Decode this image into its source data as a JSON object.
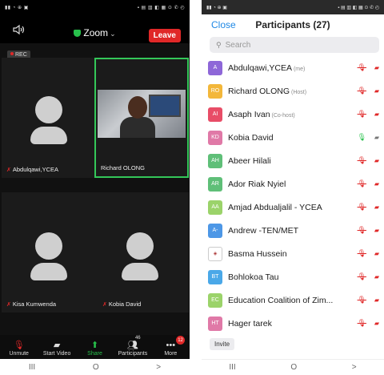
{
  "left": {
    "meeting_title": "Zoom",
    "leave_label": "Leave",
    "rec_label": "REC",
    "tiles": [
      {
        "name": "Abdulqawi,YCEA"
      },
      {
        "name": "Richard OLONG"
      },
      {
        "name": "Kisa Kumwenda"
      },
      {
        "name": "Kobia David"
      }
    ],
    "toolbar": {
      "unmute": "Unmute",
      "start_video": "Start Video",
      "share": "Share",
      "participants": "Participants",
      "participants_count": "46",
      "more": "More",
      "more_badge": "12"
    },
    "nav": {
      "recents": "III",
      "home": "O",
      "back": ">"
    }
  },
  "right": {
    "close_label": "Close",
    "title": "Participants (27)",
    "search_placeholder": "Search",
    "participants": [
      {
        "initials": "A",
        "name": "Abdulqawi,YCEA",
        "role": "(me)",
        "color": "#8e67d8",
        "mic": "muted",
        "cam": "off"
      },
      {
        "initials": "RO",
        "name": "Richard OLONG",
        "role": "(Host)",
        "color": "#f3b73a",
        "mic": "muted",
        "cam": "off"
      },
      {
        "initials": "AI",
        "name": "Asaph Ivan",
        "role": "(Co-host)",
        "color": "#e84d67",
        "mic": "muted",
        "cam": "off"
      },
      {
        "initials": "KD",
        "name": "Kobia David",
        "role": "",
        "color": "#e079a7",
        "mic": "on",
        "cam": "on"
      },
      {
        "initials": "AH",
        "name": "Abeer Hilali",
        "role": "",
        "color": "#5fbf78",
        "mic": "muted",
        "cam": "off"
      },
      {
        "initials": "AR",
        "name": "Ador Riak Nyiel",
        "role": "",
        "color": "#5fbf78",
        "mic": "muted",
        "cam": "off"
      },
      {
        "initials": "AA",
        "name": "Amjad Abdualjalil - YCEA",
        "role": "",
        "color": "#9bd36a",
        "mic": "muted",
        "cam": "off"
      },
      {
        "initials": "A-",
        "name": "Andrew -TEN/MET",
        "role": "",
        "color": "#4d97e6",
        "mic": "muted",
        "cam": "off"
      },
      {
        "initials": "",
        "name": "Basma Hussein",
        "role": "",
        "color": "#ffffff",
        "mic": "muted",
        "cam": "off"
      },
      {
        "initials": "BT",
        "name": "Bohlokoa Tau",
        "role": "",
        "color": "#4aa8e8",
        "mic": "muted",
        "cam": "off"
      },
      {
        "initials": "EC",
        "name": "Education Coalition of Zim...",
        "role": "",
        "color": "#9bd36a",
        "mic": "muted",
        "cam": "off"
      },
      {
        "initials": "HT",
        "name": "Hager tarek",
        "role": "",
        "color": "#e079a7",
        "mic": "muted",
        "cam": "off"
      }
    ],
    "invite_label": "Invite",
    "nav": {
      "recents": "III",
      "home": "O",
      "back": ">"
    }
  }
}
